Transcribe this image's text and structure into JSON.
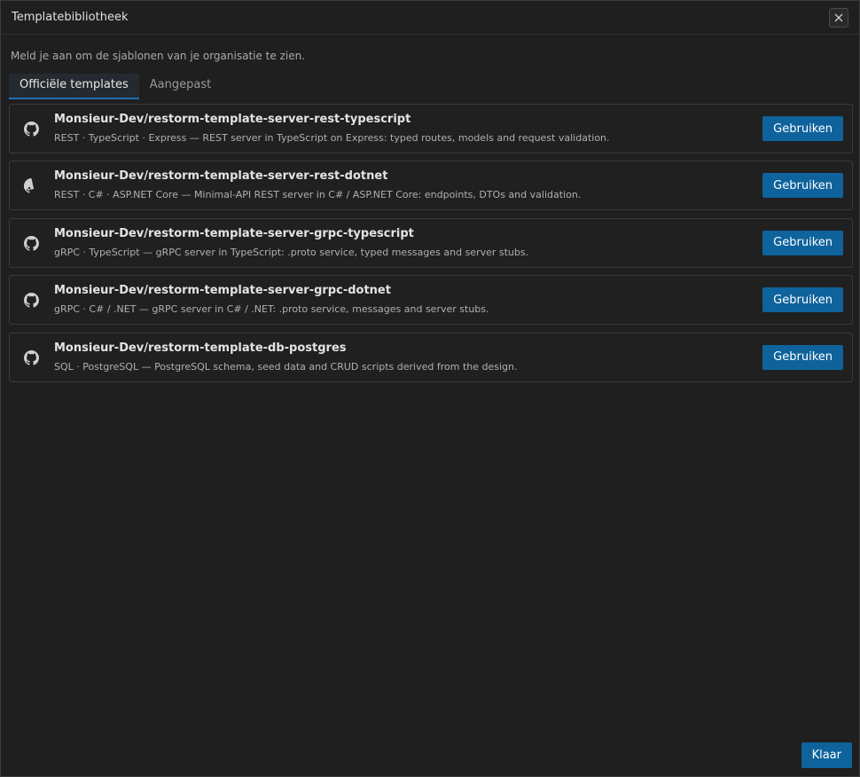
{
  "dialog": {
    "title": "Templatebibliotheek",
    "close_icon": "close-icon"
  },
  "notice": "Meld je aan om de sjablonen van je organisatie te zien.",
  "tabs": [
    {
      "label": "Officiële templates",
      "active": true
    },
    {
      "label": "Aangepast",
      "active": false
    }
  ],
  "templates": [
    {
      "icon": "github-icon",
      "name": "Monsieur-Dev/restorm-template-server-rest-typescript",
      "description": "REST · TypeScript · Express — REST server in TypeScript on Express: typed routes, models and request validation.",
      "button": "Gebruiken"
    },
    {
      "icon": "github-icon",
      "name": "Monsieur-Dev/restorm-template-server-rest-dotnet",
      "description": "REST · C# · ASP.NET Core — Minimal-API REST server in C# / ASP.NET Core: endpoints, DTOs and validation.",
      "button": "Gebruiken"
    },
    {
      "icon": "github-icon",
      "name": "Monsieur-Dev/restorm-template-server-grpc-typescript",
      "description": "gRPC · TypeScript — gRPC server in TypeScript: .proto service, typed messages and server stubs.",
      "button": "Gebruiken"
    },
    {
      "icon": "github-icon",
      "name": "Monsieur-Dev/restorm-template-server-grpc-dotnet",
      "description": "gRPC · C# / .NET — gRPC server in C# / .NET: .proto service, messages and server stubs.",
      "button": "Gebruiken"
    },
    {
      "icon": "github-icon",
      "name": "Monsieur-Dev/restorm-template-db-postgres",
      "description": "SQL · PostgreSQL — PostgreSQL schema, seed data and CRUD scripts derived from the design.",
      "button": "Gebruiken"
    }
  ],
  "footer": {
    "done_label": "Klaar"
  },
  "colors": {
    "accent": "#0e639c",
    "tab_underline": "#1f6fb4",
    "background": "#1f1f1f"
  }
}
